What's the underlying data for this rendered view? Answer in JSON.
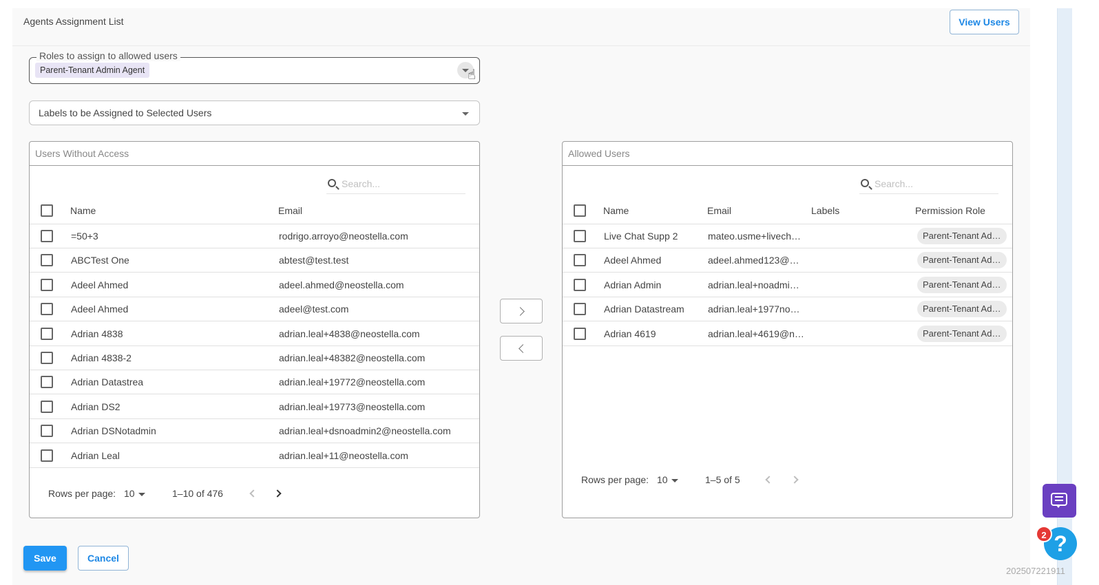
{
  "header": {
    "title": "Agents Assignment List",
    "view_users_label": "View Users"
  },
  "roles": {
    "legend": "Roles to assign to allowed users",
    "selected_chip": "Parent-Tenant Admin Agent"
  },
  "labels_select": {
    "placeholder": "Labels to be Assigned to Selected Users"
  },
  "left_panel": {
    "title": "Users Without Access",
    "search_placeholder": "Search...",
    "columns": [
      "Name",
      "Email"
    ],
    "rows": [
      {
        "name": "=50+3",
        "email": "rodrigo.arroyo@neostella.com"
      },
      {
        "name": "ABCTest One",
        "email": "abtest@test.test"
      },
      {
        "name": "Adeel Ahmed",
        "email": "adeel.ahmed@neostella.com"
      },
      {
        "name": "Adeel Ahmed",
        "email": "adeel@test.com"
      },
      {
        "name": "Adrian 4838",
        "email": "adrian.leal+4838@neostella.com"
      },
      {
        "name": "Adrian 4838-2",
        "email": "adrian.leal+48382@neostella.com"
      },
      {
        "name": "Adrian Datastrea",
        "email": "adrian.leal+19772@neostella.com"
      },
      {
        "name": "Adrian DS2",
        "email": "adrian.leal+19773@neostella.com"
      },
      {
        "name": "Adrian DSNotadmin",
        "email": "adrian.leal+dsnoadmin2@neostella.com"
      },
      {
        "name": "Adrian Leal",
        "email": "adrian.leal+11@neostella.com"
      }
    ],
    "pagination": {
      "rows_per_page_label": "Rows per page:",
      "rows_per_page": "10",
      "range": "1–10 of 476"
    }
  },
  "right_panel": {
    "title": "Allowed Users",
    "search_placeholder": "Search...",
    "columns": [
      "Name",
      "Email",
      "Labels",
      "Permission Role"
    ],
    "rows": [
      {
        "name": "Live Chat Supp 2",
        "email": "mateo.usme+livech…",
        "labels": "",
        "role": "Parent-Tenant Ad…"
      },
      {
        "name": "Adeel Ahmed",
        "email": "adeel.ahmed123@n…",
        "labels": "",
        "role": "Parent-Tenant Ad…"
      },
      {
        "name": "Adrian Admin",
        "email": "adrian.leal+noadmi…",
        "labels": "",
        "role": "Parent-Tenant Ad…"
      },
      {
        "name": "Adrian Datastream",
        "email": "adrian.leal+1977no…",
        "labels": "",
        "role": "Parent-Tenant Ad…"
      },
      {
        "name": "Adrian 4619",
        "email": "adrian.leal+4619@n…",
        "labels": "",
        "role": "Parent-Tenant Ad…"
      }
    ],
    "pagination": {
      "rows_per_page_label": "Rows per page:",
      "rows_per_page": "10",
      "range": "1–5 of 5"
    }
  },
  "actions": {
    "save_label": "Save",
    "cancel_label": "Cancel"
  },
  "widgets": {
    "help_label": "?",
    "help_badge": "2"
  },
  "footer_stamp": "202507221911",
  "colors": {
    "accent": "#2196f3",
    "chat": "#6a3fc1",
    "help": "#1ea0e6",
    "badge": "#e53935"
  },
  "icons": [
    "search-icon",
    "chevron-down-icon",
    "chevron-left-icon",
    "chevron-right-icon",
    "chat-icon",
    "help-icon"
  ]
}
